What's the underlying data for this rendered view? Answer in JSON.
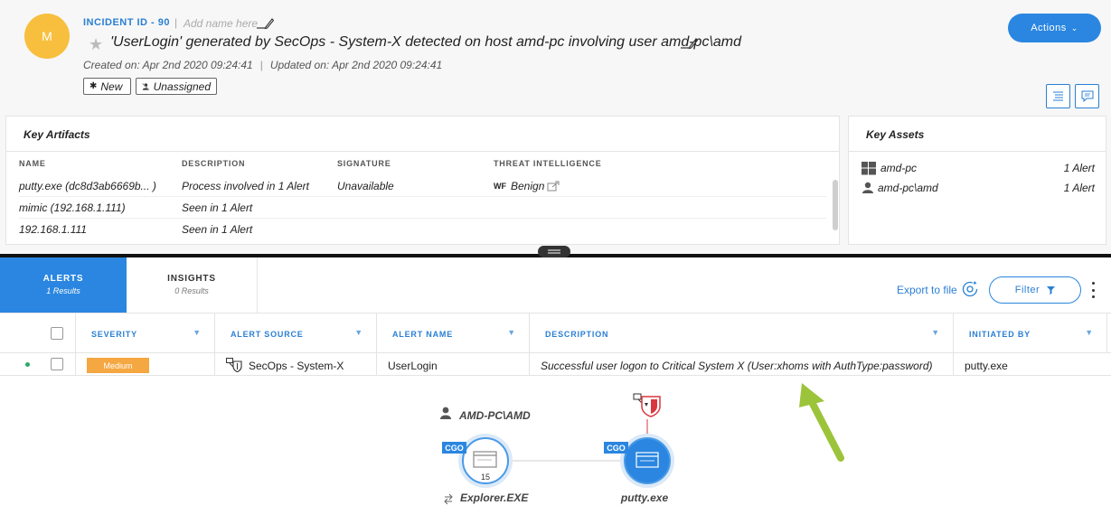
{
  "header": {
    "avatar_initial": "M",
    "incident_id": "INCIDENT ID - 90",
    "separator": "|",
    "add_name_placeholder": "Add name here",
    "title": "'UserLogin' generated by SecOps - System-X detected on host amd-pc involving user amd-pc\\amd",
    "created": "Created on: Apr 2nd 2020 09:24:41",
    "updated": "Updated on: Apr 2nd 2020 09:24:41",
    "status_tag": "New",
    "assignee_tag": "Unassigned",
    "actions_label": "Actions"
  },
  "artifacts": {
    "title": "Key Artifacts",
    "columns": [
      "NAME",
      "DESCRIPTION",
      "SIGNATURE",
      "THREAT INTELLIGENCE"
    ],
    "rows": [
      {
        "name": "putty.exe (dc8d3ab6669b... )",
        "description": "Process involved in 1 Alert",
        "signature": "Unavailable",
        "ti_badge": "WF",
        "ti_value": "Benign"
      },
      {
        "name": "mimic (192.168.1.111)",
        "description": "Seen in 1 Alert",
        "signature": "",
        "ti_badge": "",
        "ti_value": ""
      },
      {
        "name": "192.168.1.111",
        "description": "Seen in 1 Alert",
        "signature": "",
        "ti_badge": "",
        "ti_value": ""
      }
    ]
  },
  "assets": {
    "title": "Key Assets",
    "rows": [
      {
        "icon": "windows-icon",
        "name": "amd-pc",
        "count": "1 Alert"
      },
      {
        "icon": "user-icon",
        "name": "amd-pc\\amd",
        "count": "1 Alert"
      }
    ]
  },
  "tabs": [
    {
      "label": "ALERTS",
      "sub": "1 Results"
    },
    {
      "label": "INSIGHTS",
      "sub": "0 Results"
    }
  ],
  "toolbar": {
    "export_label": "Export to file",
    "filter_label": "Filter"
  },
  "alerts_table": {
    "columns": [
      "SEVERITY",
      "ALERT SOURCE",
      "ALERT NAME",
      "DESCRIPTION",
      "INITIATED BY"
    ],
    "row": {
      "severity": "Medium",
      "source": "SecOps - System-X",
      "name": "UserLogin",
      "description": "Successful user logon to Critical System X (User:xhoms with AuthType:password)",
      "initiated_by": "putty.exe"
    }
  },
  "graph": {
    "user_label": "AMD-PC\\AMD",
    "nodes": [
      {
        "badge": "CGO",
        "label": "Explorer.EXE",
        "count": "15"
      },
      {
        "badge": "CGO",
        "label": "putty.exe",
        "count": ""
      }
    ]
  },
  "colors": {
    "accent": "#2a86e0",
    "avatar": "#f7bf3d",
    "medium": "#f5a742",
    "arrow": "#9cc43a",
    "alert_red": "#d9363e"
  }
}
